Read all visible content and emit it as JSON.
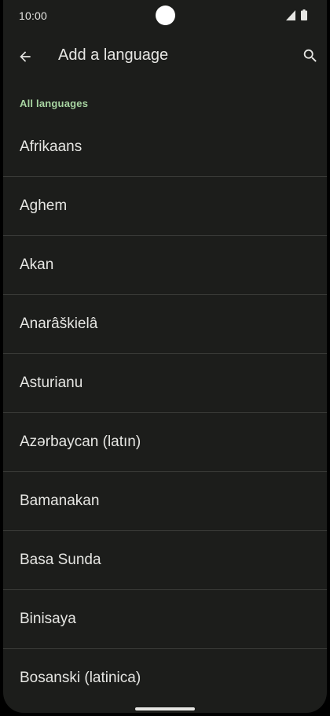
{
  "status_bar": {
    "time": "10:00",
    "icons": [
      "signal-icon",
      "battery-icon"
    ]
  },
  "app_bar": {
    "title": "Add a language",
    "back_icon": "arrow-back-icon",
    "search_icon": "search-icon"
  },
  "section": {
    "header": "All languages"
  },
  "languages": [
    {
      "label": "Afrikaans"
    },
    {
      "label": "Aghem"
    },
    {
      "label": "Akan"
    },
    {
      "label": "Anarâškielâ"
    },
    {
      "label": "Asturianu"
    },
    {
      "label": "Azərbaycan (latın)"
    },
    {
      "label": "Bamanakan"
    },
    {
      "label": "Basa Sunda"
    },
    {
      "label": "Binisaya"
    },
    {
      "label": "Bosanski (latinica)"
    }
  ],
  "colors": {
    "background": "#1c1d1b",
    "text": "#e6e6e3",
    "accent": "#a8d5a2",
    "divider": "#3b3c39"
  }
}
